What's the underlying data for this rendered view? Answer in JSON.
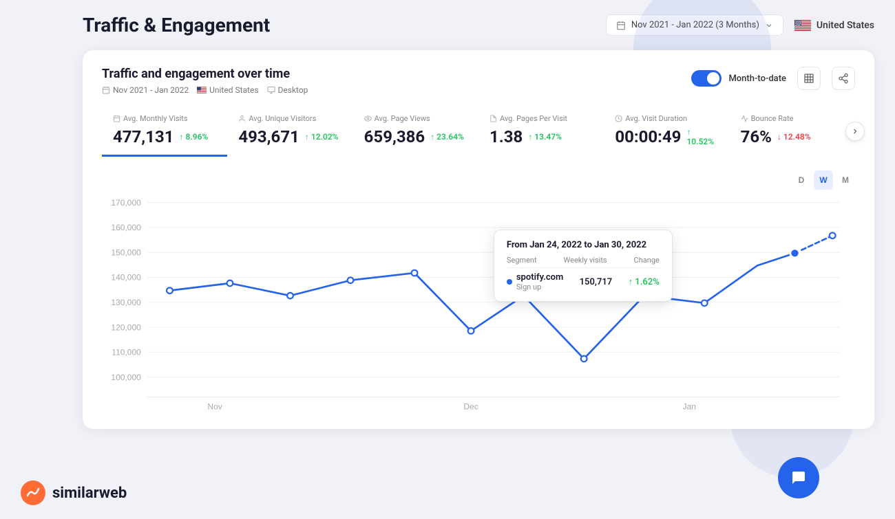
{
  "page": {
    "title": "Traffic & Engagement"
  },
  "header": {
    "date_range_label": "Nov 2021 - Jan 2022 (3 Months)",
    "date_range_icon": "calendar-icon",
    "country": "United States",
    "country_icon": "us-flag-icon",
    "dropdown_icon": "chevron-down-icon"
  },
  "card": {
    "title": "Traffic and engagement over time",
    "meta": {
      "date_range": "Nov 2021 - Jan 2022",
      "country": "United States",
      "device": "Desktop"
    },
    "toggle_label": "Month-to-date",
    "excel_icon": "excel-icon",
    "share_icon": "share-icon"
  },
  "metrics": [
    {
      "label": "Avg. Monthly Visits",
      "value": "477,131",
      "change": "↑ 8.96%",
      "change_type": "up",
      "active": true,
      "icon": "calendar-metric-icon"
    },
    {
      "label": "Avg. Unique Visitors",
      "value": "493,671",
      "change": "↑ 12.02%",
      "change_type": "up",
      "active": false,
      "icon": "user-metric-icon"
    },
    {
      "label": "Avg. Page Views",
      "value": "659,386",
      "change": "↑ 23.64%",
      "change_type": "up",
      "active": false,
      "icon": "eye-metric-icon"
    },
    {
      "label": "Avg. Pages Per Visit",
      "value": "1.38",
      "change": "↑ 13.47%",
      "change_type": "up",
      "active": false,
      "icon": "pages-metric-icon"
    },
    {
      "label": "Avg. Visit Duration",
      "value": "00:00:49",
      "change": "↑ 10.52%",
      "change_type": "up",
      "active": false,
      "icon": "clock-metric-icon"
    },
    {
      "label": "Bounce Rate",
      "value": "76%",
      "change": "↓ 12.48%",
      "change_type": "down",
      "active": false,
      "icon": "bounce-metric-icon"
    }
  ],
  "chart": {
    "granularity_buttons": [
      {
        "label": "D",
        "active": false
      },
      {
        "label": "W",
        "active": true
      },
      {
        "label": "M",
        "active": false
      }
    ],
    "y_axis_labels": [
      "170,000",
      "160,000",
      "150,000",
      "140,000",
      "130,000",
      "120,000",
      "110,000",
      "100,000"
    ],
    "x_axis_labels": [
      "Nov",
      "Dec",
      "Jan"
    ]
  },
  "tooltip": {
    "title": "From Jan 24, 2022 to Jan 30, 2022",
    "col_segment": "Segment",
    "col_visits": "Weekly visits",
    "col_change": "Change",
    "row_site": "spotify.com",
    "row_sub": "Sign up",
    "row_visits": "150,717",
    "row_change": "↑ 1.62%",
    "row_change_type": "up"
  },
  "logo": {
    "text": "similarweb"
  },
  "colors": {
    "primary": "#2563eb",
    "positive": "#22c55e",
    "negative": "#ef4444",
    "active_tab": "#2563eb"
  }
}
